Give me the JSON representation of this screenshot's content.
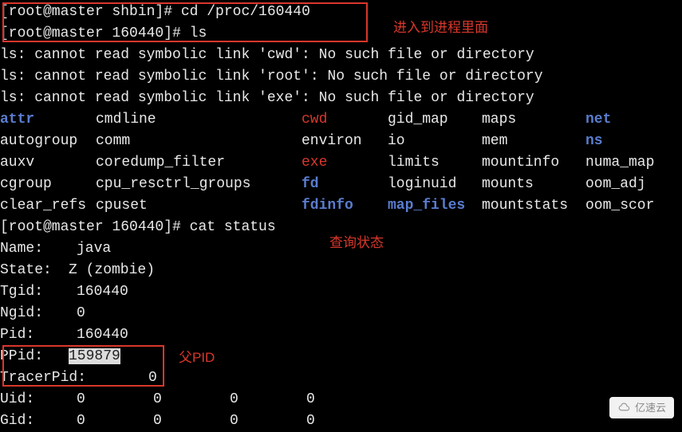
{
  "prompt1": "[root@master shbin]# ",
  "cmd1": "cd /proc/160440",
  "prompt2": "[root@master 160440]# ",
  "cmd2": "ls",
  "err1": "ls: cannot read symbolic link 'cwd': No such file or directory",
  "err2": "ls: cannot read symbolic link 'root': No such file or directory",
  "err3": "ls: cannot read symbolic link 'exe': No such file or directory",
  "ls": {
    "r1": {
      "a": "attr",
      "b": "cmdline",
      "c": "cwd",
      "d": "gid_map",
      "e": "maps",
      "f": "net"
    },
    "r2": {
      "a": "autogroup",
      "b": "comm",
      "c": "environ",
      "d": "io",
      "e": "mem",
      "f": "ns"
    },
    "r3": {
      "a": "auxv",
      "b": "coredump_filter",
      "c": "exe",
      "d": "limits",
      "e": "mountinfo",
      "f": "numa_map"
    },
    "r4": {
      "a": "cgroup",
      "b": "cpu_resctrl_groups",
      "c": "fd",
      "d": "loginuid",
      "e": "mounts",
      "f": "oom_adj"
    },
    "r5": {
      "a": "clear_refs",
      "b": "cpuset",
      "c": "fdinfo",
      "d": "map_files",
      "e": "mountstats",
      "f": "oom_scor"
    }
  },
  "prompt3": "[root@master 160440]# ",
  "cmd3": "cat status",
  "status": {
    "name_k": "Name:",
    "name_v": "java",
    "state_k": "State:",
    "state_v": "Z (zombie)",
    "tgid_k": "Tgid:",
    "tgid_v": "160440",
    "ngid_k": "Ngid:",
    "ngid_v": "0",
    "pid_k": "Pid:",
    "pid_v": "160440",
    "ppid_k": "PPid:",
    "ppid_v": "159879",
    "tracer_k": "TracerPid:",
    "tracer_v": "0",
    "uid_k": "Uid:",
    "uid_a": "0",
    "uid_b": "0",
    "uid_c": "0",
    "uid_d": "0",
    "gid_k": "Gid:",
    "gid_a": "0",
    "gid_b": "0",
    "gid_c": "0",
    "gid_d": "0"
  },
  "annot": {
    "a1": "进入到进程里面",
    "a2": "查询状态",
    "a3": "父PID"
  },
  "watermark": "亿速云"
}
